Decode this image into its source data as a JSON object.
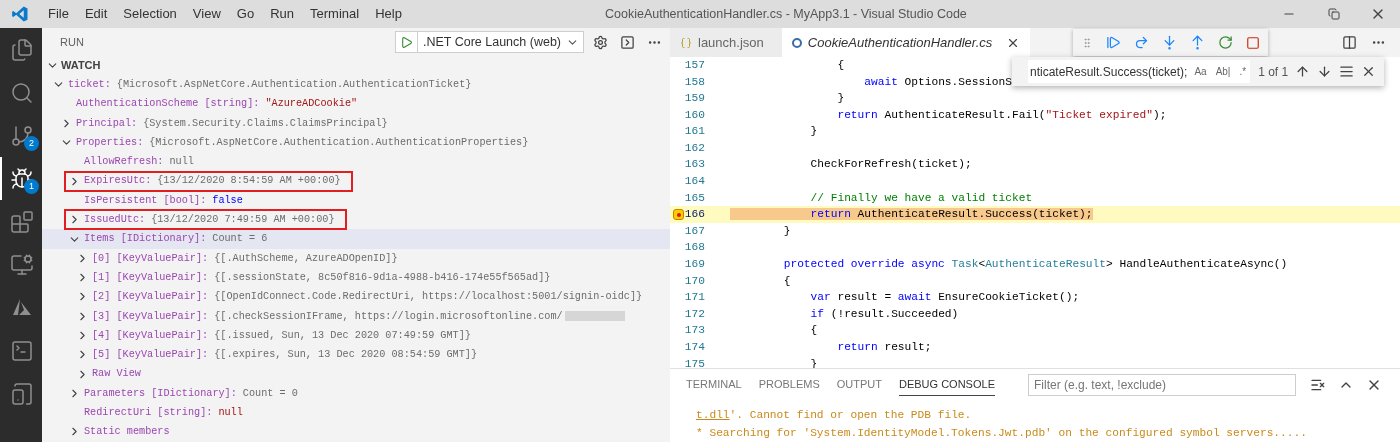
{
  "title_bar": {
    "menu": [
      "File",
      "Edit",
      "Selection",
      "View",
      "Go",
      "Run",
      "Terminal",
      "Help"
    ],
    "title": "CookieAuthenticationHandler.cs - MyApp3.1 - Visual Studio Code"
  },
  "activity_bar": [
    {
      "kind": "files",
      "selected": false
    },
    {
      "kind": "search",
      "selected": false
    },
    {
      "kind": "source-control",
      "selected": false,
      "badge": "2"
    },
    {
      "kind": "run",
      "selected": true,
      "badge": "1"
    },
    {
      "kind": "extensions",
      "selected": false
    },
    {
      "kind": "remote",
      "selected": false
    },
    {
      "kind": "azure",
      "selected": false
    },
    {
      "kind": "terminal",
      "selected": false
    },
    {
      "kind": "device",
      "selected": false
    }
  ],
  "sidebar": {
    "title": "RUN",
    "launch_config": ".NET Core Launch (web)",
    "section": {
      "title": "WATCH",
      "expanded": true
    }
  },
  "watch": [
    {
      "name": "ticket:",
      "value": "{Microsoft.AspNetCore.Authentication.AuthenticationTicket}",
      "kind": "object",
      "expanded": true,
      "selected": false,
      "annotated": false,
      "children": [
        {
          "name": "AuthenticationScheme [string]:",
          "value": "\"AzureADCookie\"",
          "kind": "string",
          "selected": false,
          "annotated": false
        },
        {
          "name": "Principal:",
          "value": "{System.Security.Claims.ClaimsPrincipal}",
          "kind": "object",
          "expanded": false,
          "selected": false,
          "annotated": false
        },
        {
          "name": "Properties:",
          "value": "{Microsoft.AspNetCore.Authentication.AuthenticationProperties}",
          "kind": "object",
          "expanded": true,
          "selected": false,
          "annotated": false,
          "children": [
            {
              "name": "AllowRefresh:",
              "value": "null",
              "kind": "object",
              "selected": false,
              "annotated": false
            },
            {
              "name": "ExpiresUtc:",
              "value": "{13/12/2020 8:54:59 AM +00:00}",
              "kind": "object",
              "expanded": false,
              "selected": false,
              "annotated": true
            },
            {
              "name": "IsPersistent [bool]:",
              "value": "false",
              "kind": "boolean",
              "selected": false,
              "annotated": false
            },
            {
              "name": "IssuedUtc:",
              "value": "{13/12/2020 7:49:59 AM +00:00}",
              "kind": "object",
              "expanded": false,
              "selected": false,
              "annotated": true
            },
            {
              "name": "Items [IDictionary]:",
              "value": "Count = 6",
              "kind": "object",
              "expanded": true,
              "selected": true,
              "annotated": false,
              "children": [
                {
                  "name": "[0] [KeyValuePair]:",
                  "value": "{[.AuthScheme, AzureADOpenID]}",
                  "kind": "object",
                  "expanded": false,
                  "selected": false,
                  "annotated": false
                },
                {
                  "name": "[1] [KeyValuePair]:",
                  "value": "{[.sessionState, 8c50f816-9d1a-4988-b416-174e55f565ad]}",
                  "kind": "object",
                  "expanded": false,
                  "selected": false,
                  "annotated": false
                },
                {
                  "name": "[2] [KeyValuePair]:",
                  "value": "{[OpenIdConnect.Code.RedirectUri, https://localhost:5001/signin-oidc]}",
                  "kind": "object",
                  "expanded": false,
                  "selected": false,
                  "annotated": false
                },
                {
                  "name": "[3] [KeyValuePair]:",
                  "value": "{[.checkSessionIFrame, https://login.microsoftonline.com/",
                  "kind": "object",
                  "expanded": false,
                  "selected": false,
                  "annotated": false,
                  "redacted": true
                },
                {
                  "name": "[4] [KeyValuePair]:",
                  "value": "{[.issued, Sun, 13 Dec 2020 07:49:59 GMT]}",
                  "kind": "object",
                  "expanded": false,
                  "selected": false,
                  "annotated": false
                },
                {
                  "name": "[5] [KeyValuePair]:",
                  "value": "{[.expires, Sun, 13 Dec 2020 08:54:59 GMT]}",
                  "kind": "object",
                  "expanded": false,
                  "selected": false,
                  "annotated": false
                },
                {
                  "name": "Raw View",
                  "expanded": false,
                  "selected": false,
                  "annotated": false
                }
              ]
            },
            {
              "name": "Parameters [IDictionary]:",
              "value": "Count = 0",
              "kind": "object",
              "expanded": false,
              "selected": false,
              "annotated": false
            },
            {
              "name": "RedirectUri [string]:",
              "value": "null",
              "kind": "string",
              "selected": false,
              "annotated": false
            },
            {
              "name": "Static members",
              "expanded": false,
              "selected": false,
              "annotated": false
            }
          ]
        }
      ]
    }
  ],
  "editor_tabs": [
    {
      "label": "launch.json",
      "kind": "json",
      "selected": false
    },
    {
      "label": "CookieAuthenticationHandler.cs",
      "kind": "csharp",
      "selected": true
    }
  ],
  "find_widget": {
    "value": "nticateResult.Success(ticket);",
    "options": [
      "Aa",
      "Ab|",
      ".*"
    ],
    "result": "1 of 1"
  },
  "code": [
    {
      "n": "157",
      "current": false,
      "tokens": [
        {
          "t": "                {",
          "kind": "plain"
        }
      ]
    },
    {
      "n": "158",
      "current": false,
      "tokens": [
        {
          "t": "                    await",
          "kind": "keyword"
        },
        {
          "t": " Options.SessionS",
          "kind": "plain"
        }
      ]
    },
    {
      "n": "159",
      "current": false,
      "tokens": [
        {
          "t": "                }",
          "kind": "plain"
        }
      ]
    },
    {
      "n": "160",
      "current": false,
      "tokens": [
        {
          "t": "                return",
          "kind": "keyword"
        },
        {
          "t": " AuthenticateResult.Fail(",
          "kind": "plain"
        },
        {
          "t": "\"Ticket expired\"",
          "kind": "string"
        },
        {
          "t": ");",
          "kind": "plain"
        }
      ]
    },
    {
      "n": "161",
      "current": false,
      "tokens": [
        {
          "t": "            }",
          "kind": "plain"
        }
      ]
    },
    {
      "n": "162",
      "current": false
    },
    {
      "n": "163",
      "current": false,
      "tokens": [
        {
          "t": "            CheckForRefresh(ticket);",
          "kind": "plain"
        }
      ]
    },
    {
      "n": "164",
      "current": false
    },
    {
      "n": "165",
      "current": false,
      "tokens": [
        {
          "t": "            // Finally we have a valid ticket",
          "kind": "comment"
        }
      ]
    },
    {
      "n": "166",
      "current": true,
      "tokens": [
        {
          "t": "            return",
          "kind": "keyword"
        },
        {
          "t": " AuthenticateResult.Success(ticket);",
          "kind": "plain"
        }
      ]
    },
    {
      "n": "167",
      "current": false,
      "tokens": [
        {
          "t": "        }",
          "kind": "plain"
        }
      ]
    },
    {
      "n": "168",
      "current": false
    },
    {
      "n": "169",
      "current": false,
      "tokens": [
        {
          "t": "        protected override async",
          "kind": "keyword"
        },
        {
          "t": " Task",
          "kind": "type"
        },
        {
          "t": "<",
          "kind": "plain"
        },
        {
          "t": "AuthenticateResult",
          "kind": "type"
        },
        {
          "t": "> HandleAuthenticateAsync()",
          "kind": "plain"
        }
      ]
    },
    {
      "n": "170",
      "current": false,
      "tokens": [
        {
          "t": "        {",
          "kind": "plain"
        }
      ]
    },
    {
      "n": "171",
      "current": false,
      "tokens": [
        {
          "t": "            var",
          "kind": "keyword"
        },
        {
          "t": " result = ",
          "kind": "plain"
        },
        {
          "t": "await",
          "kind": "keyword"
        },
        {
          "t": " EnsureCookieTicket();",
          "kind": "plain"
        }
      ]
    },
    {
      "n": "172",
      "current": false,
      "tokens": [
        {
          "t": "            if",
          "kind": "keyword"
        },
        {
          "t": " (!result.Succeeded)",
          "kind": "plain"
        }
      ]
    },
    {
      "n": "173",
      "current": false,
      "tokens": [
        {
          "t": "            {",
          "kind": "plain"
        }
      ]
    },
    {
      "n": "174",
      "current": false,
      "tokens": [
        {
          "t": "                return",
          "kind": "keyword"
        },
        {
          "t": " result;",
          "kind": "plain"
        }
      ]
    },
    {
      "n": "175",
      "current": false,
      "tokens": [
        {
          "t": "            }",
          "kind": "plain"
        }
      ]
    }
  ],
  "panel": {
    "tabs": [
      {
        "label": "TERMINAL",
        "selected": false
      },
      {
        "label": "PROBLEMS",
        "selected": false
      },
      {
        "label": "OUTPUT",
        "selected": false
      },
      {
        "label": "DEBUG CONSOLE",
        "selected": true
      }
    ],
    "filter_placeholder": "Filter (e.g. text, !exclude)",
    "output": [
      {
        "link": "t.dll",
        "text": "'. Cannot find or open the PDB file."
      },
      {
        "text": "* Searching for 'System.IdentityModel.Tokens.Jwt.pdb' on the configured symbol servers....."
      }
    ]
  }
}
